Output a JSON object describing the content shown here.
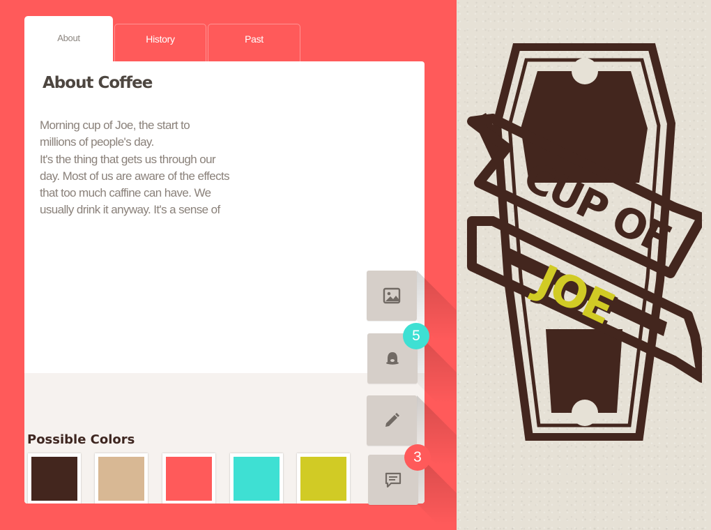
{
  "tabs": [
    {
      "label": "About",
      "active": true
    },
    {
      "label": "History",
      "active": false
    },
    {
      "label": "Past",
      "active": false
    }
  ],
  "card": {
    "title": "About Coffee",
    "body_lines": [
      "Morning cup of Joe, the start to",
      "millions of people's day.",
      "It's the thing that gets us through our",
      "day. Most of us are aware of the effects",
      "that too much caffine can have. We",
      "usually drink it anyway. It's a sense of"
    ]
  },
  "palette": {
    "title": "Possible Colors",
    "colors": [
      "#43261e",
      "#d8b894",
      "#ff5a5a",
      "#3ee0d3",
      "#d1cb25"
    ]
  },
  "actions": [
    {
      "icon": "image-icon",
      "badge": null
    },
    {
      "icon": "bell-icon",
      "badge": "5",
      "badge_color": "#3ee0d3"
    },
    {
      "icon": "pencil-icon",
      "badge": null
    },
    {
      "icon": "comment-icon",
      "badge": "3",
      "badge_color": "#ff5a5a"
    }
  ],
  "logo": {
    "line1": "CUP OF",
    "line2": "JOE",
    "brown": "#43261e",
    "yellow": "#d1cb25"
  },
  "colors": {
    "background": "#ff5a5a",
    "paper": "#e6e1d6",
    "card": "#ffffff"
  }
}
